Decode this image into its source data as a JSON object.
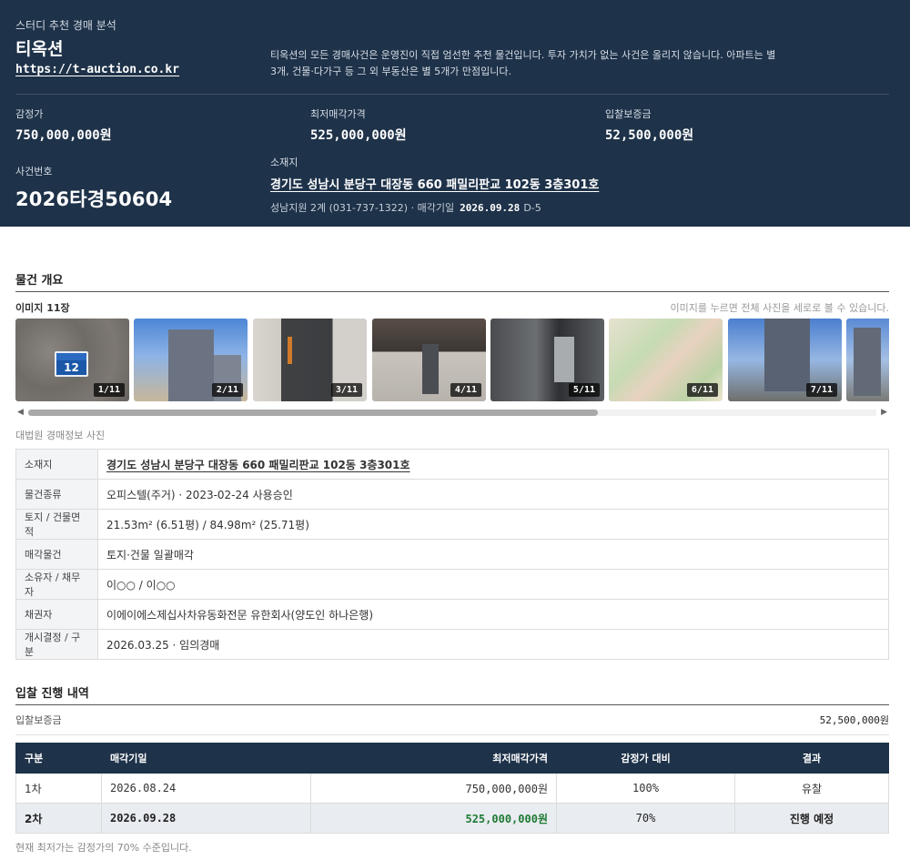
{
  "header": {
    "subtitle": "스터디 추천 경매 분석",
    "brand": "티옥션",
    "url": "https://t-auction.co.kr",
    "description": "티옥션의 모든 경매사건은 운영진이 직접 엄선한 추천 물건입니다. 투자 가치가 없는 사건은 올리지 않습니다. 아파트는 별 3개, 건물·다가구 등 그 외 부동산은 별 5개가 만점입니다.",
    "appraisal_label": "감정가",
    "appraisal_value": "750,000,000원",
    "min_price_label": "최저매각가격",
    "min_price_value": "525,000,000원",
    "deposit_label": "입찰보증금",
    "deposit_value": "52,500,000원",
    "case_label": "사건번호",
    "case_value": "2026타경50604",
    "location_label": "소재지",
    "location_value": "경기도 성남시 분당구 대장동 660 패밀리판교 102동 3층301호",
    "court": "성남지원 2계 (031-737-1322) · 매각기일",
    "sale_date": "2026.09.28",
    "dday": "D-5"
  },
  "overview": {
    "title": "물건 개요",
    "image_count": "이미지 11장",
    "image_hint": "이미지를 누르면 전체 사진을 세로로 볼 수 있습니다.",
    "sign_number": "12",
    "thumbs": [
      "1/11",
      "2/11",
      "3/11",
      "4/11",
      "5/11",
      "6/11",
      "7/11"
    ],
    "photo_caption": "대법원 경매정보 사진"
  },
  "info_table": [
    {
      "label": "소재지",
      "value": "경기도 성남시 분당구 대장동 660 패밀리판교 102동 3층301호"
    },
    {
      "label": "물건종류",
      "value": "오피스텔(주거) · 2023-02-24 사용승인"
    },
    {
      "label": "토지 / 건물면적",
      "value": "21.53m² (6.51평) / 84.98m² (25.71평)"
    },
    {
      "label": "매각물건",
      "value": "토지·건물 일괄매각"
    },
    {
      "label": "소유자 / 채무자",
      "value": "이○○ / 이○○"
    },
    {
      "label": "채권자",
      "value": "이에이에스제십사차유동화전문 유한회사(양도인 하나은행)"
    },
    {
      "label": "개시결정 / 구분",
      "value": "2026.03.25 · 임의경매"
    }
  ],
  "bidding": {
    "title": "입찰 진행 내역",
    "deposit_label": "입찰보증금",
    "deposit_value": "52,500,000원",
    "columns": [
      "구분",
      "매각기일",
      "최저매각가격",
      "감정가 대비",
      "결과"
    ],
    "rows": [
      {
        "round": "1차",
        "date": "2026.08.24",
        "price": "750,000,000원",
        "ratio": "100%",
        "result": "유찰"
      },
      {
        "round": "2차",
        "date": "2026.09.28",
        "price": "525,000,000원",
        "ratio": "70%",
        "result": "진행 예정"
      }
    ],
    "footnote": "현재 최저가는 감정가의 70% 수준입니다."
  },
  "colors": {
    "header_bg": "#1e3249",
    "accent_green": "#1f7a34"
  }
}
